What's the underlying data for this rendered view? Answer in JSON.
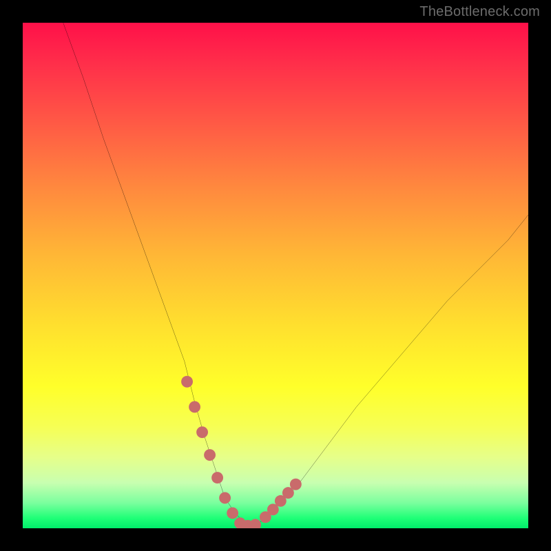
{
  "watermark": "TheBottleneck.com",
  "chart_data": {
    "type": "line",
    "title": "",
    "xlabel": "",
    "ylabel": "",
    "xlim": [
      0,
      100
    ],
    "ylim": [
      0,
      100
    ],
    "grid": false,
    "legend": false,
    "series": [
      {
        "name": "bottleneck-curve",
        "x": [
          8,
          12,
          16,
          20,
          24,
          28,
          32,
          34,
          36,
          38,
          40,
          42,
          44,
          46,
          48,
          54,
          60,
          66,
          72,
          78,
          84,
          90,
          96,
          100
        ],
        "y": [
          100,
          89,
          77,
          66,
          55,
          44,
          33,
          25,
          18,
          12,
          6,
          3,
          1,
          0.5,
          2,
          8,
          16,
          24,
          31,
          38,
          45,
          51,
          57,
          62
        ]
      }
    ],
    "markers": [
      {
        "name": "highlight-left-branch",
        "x": [
          32.5,
          34,
          35.5,
          37,
          38.5,
          40,
          41.5
        ],
        "y": [
          29,
          24,
          19,
          14.5,
          10,
          6,
          3
        ]
      },
      {
        "name": "highlight-valley",
        "x": [
          43,
          44.5,
          46
        ],
        "y": [
          1,
          0.5,
          0.7
        ]
      },
      {
        "name": "highlight-right-branch",
        "x": [
          48,
          49.5,
          51,
          52.5,
          54
        ],
        "y": [
          2.2,
          3.7,
          5.4,
          7,
          8.7
        ]
      }
    ],
    "colors": {
      "curve": "#000000",
      "marker": "#c96b6b",
      "gradient_top": "#ff1049",
      "gradient_bottom": "#00ed6a"
    }
  }
}
